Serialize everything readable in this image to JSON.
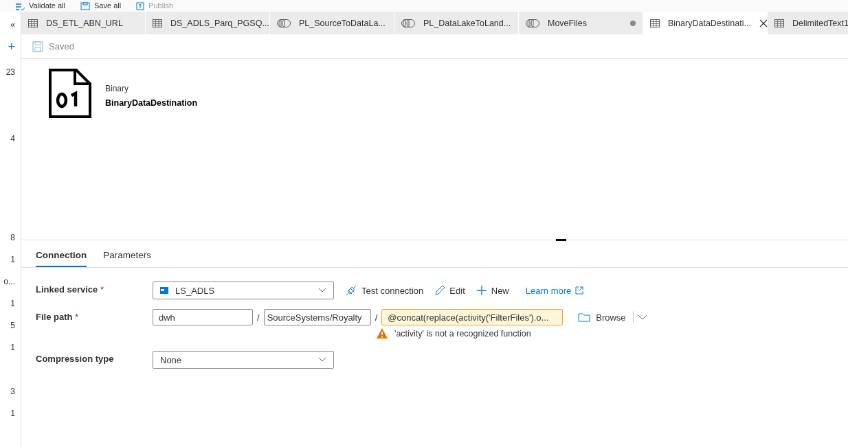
{
  "toolbar": [
    {
      "label": "Validate all",
      "kind": "validate"
    },
    {
      "label": "Save all",
      "kind": "save"
    },
    {
      "label": "Publish",
      "kind": "publish"
    }
  ],
  "sidebar": {
    "items": [
      "«",
      "+",
      "23",
      "4",
      "8",
      "1",
      "o...",
      "1",
      "5",
      "1",
      "3",
      "1"
    ]
  },
  "tabs": [
    {
      "label": "DS_ETL_ABN_URL",
      "kind": "dataset",
      "selected": false,
      "unsaved": false
    },
    {
      "label": "DS_ADLS_Parq_PGSQ...",
      "kind": "dataset",
      "selected": false,
      "unsaved": false
    },
    {
      "label": "PL_SourceToDataLa...",
      "kind": "pipeline",
      "selected": false,
      "unsaved": false
    },
    {
      "label": "PL_DataLakeToLand...",
      "kind": "pipeline",
      "selected": false,
      "unsaved": false
    },
    {
      "label": "MoveFiles",
      "kind": "pipeline",
      "selected": false,
      "unsaved": true
    },
    {
      "label": "BinaryDataDestinati...",
      "kind": "dataset",
      "selected": true,
      "unsaved": false
    },
    {
      "label": "DelimitedText1",
      "kind": "dataset",
      "selected": false,
      "unsaved": false
    }
  ],
  "save_status": {
    "label": "Saved"
  },
  "dataset": {
    "type": "Binary",
    "name": "BinaryDataDestination"
  },
  "panel_tabs": [
    {
      "label": "Connection",
      "selected": true
    },
    {
      "label": "Parameters",
      "selected": false
    }
  ],
  "form": {
    "linked_service": {
      "label": "Linked service",
      "required_mark": "*",
      "value": "LS_ADLS",
      "actions": [
        {
          "label": "Test connection",
          "kind": "test"
        },
        {
          "label": "Edit",
          "kind": "edit"
        },
        {
          "label": "New",
          "kind": "new"
        },
        {
          "label": "Learn more",
          "kind": "link"
        }
      ]
    },
    "file_path": {
      "label": "File path",
      "required_mark": "*",
      "separator": "/",
      "parts": [
        {
          "value": "dwh",
          "invalid": false
        },
        {
          "value": "SourceSystems/Royalty",
          "invalid": false
        },
        {
          "value": "@concat(replace(activity('FilterFiles').o...",
          "invalid": true
        }
      ],
      "error": "'activity' is not a recognized function",
      "browse": "Browse"
    },
    "compression_type": {
      "label": "Compression type",
      "value": "None"
    }
  }
}
